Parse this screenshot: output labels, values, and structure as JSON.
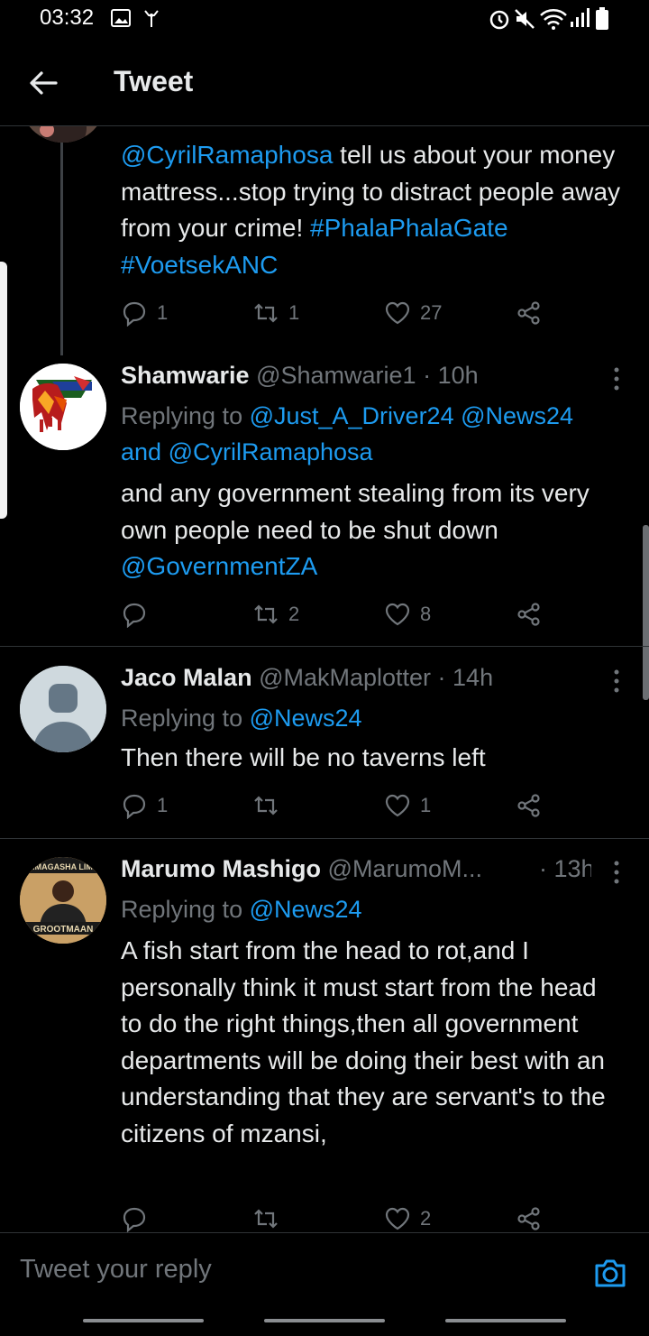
{
  "status": {
    "time": "03:32"
  },
  "header": {
    "title": "Tweet"
  },
  "tweets": [
    {
      "body_parts": [
        {
          "text": "@CyrilRamaphosa",
          "link": true
        },
        {
          "text": " tell us about your money mattress...stop trying to distract people away from your crime! ",
          "link": false
        },
        {
          "text": "#PhalaPhalaGate",
          "link": true
        },
        {
          "text": " ",
          "link": false
        },
        {
          "text": "#VoetsekANC",
          "link": true
        }
      ],
      "replies": "1",
      "retweets": "1",
      "likes": "27"
    },
    {
      "name": "Shamwarie",
      "handle": "@Shamwarie1 · 10h",
      "replying_prefix": "Replying to ",
      "replying_to": [
        "@Just_A_Driver24",
        "@News24"
      ],
      "replying_and": "and",
      "replying_to_last": "@CyrilRamaphosa",
      "body_text": "and any government stealing from its very own people need to be shut down ",
      "body_mention": "@GovernmentZA",
      "replies": "",
      "retweets": "2",
      "likes": "8"
    },
    {
      "name": "Jaco Malan",
      "handle": "@MakMaplotter · 14h",
      "replying_prefix": "Replying to ",
      "replying_to": "@News24",
      "body_text": "Then there will be no taverns left",
      "replies": "1",
      "retweets": "",
      "likes": "1"
    },
    {
      "name": "Marumo Mashigo",
      "handle": "@MarumoM...",
      "time": "· 13h",
      "replying_prefix": "Replying to ",
      "replying_to": "@News24",
      "body_text": "A fish start from the head to rot,and I personally think it must start from the head to do the right things,then all government departments will be doing their best with an understanding that they are servant's to the citizens of mzansi,",
      "avatar_text_top": "NTIMAGASHA LIMPO",
      "avatar_text_bottom": "GROOTMAAN",
      "replies": "",
      "retweets": "",
      "likes": "2"
    }
  ],
  "reply_bar": {
    "placeholder": "Tweet your reply"
  },
  "colors": {
    "link": "#1d9bf0",
    "muted": "#71767b",
    "text": "#e7e9ea",
    "divider": "#2f3336"
  }
}
